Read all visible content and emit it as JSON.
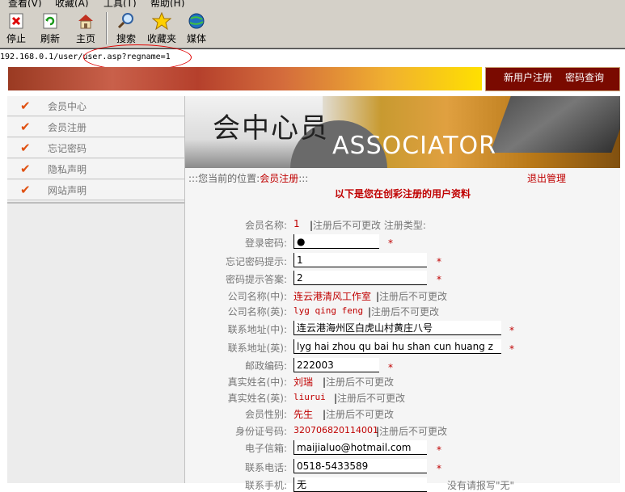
{
  "menubar": [
    "查看(V)",
    "收藏(A)",
    "工具(T)",
    "帮助(H)"
  ],
  "toolbar": [
    {
      "label": "停止",
      "icon": "stop-icon"
    },
    {
      "label": "刷新",
      "icon": "refresh-icon"
    },
    {
      "label": "主页",
      "icon": "home-icon"
    },
    {
      "label": "搜索",
      "icon": "search-icon"
    },
    {
      "label": "收藏夹",
      "icon": "star-icon"
    },
    {
      "label": "媒体",
      "icon": "media-icon"
    }
  ],
  "address": {
    "url": "192.168.0.1/user/user.asp?regname=1"
  },
  "banner": {
    "register_link": "新用户注册",
    "query_link": "密码查询"
  },
  "sidebar": {
    "items": [
      "会员中心",
      "会员注册",
      "忘记密码",
      "隐私声明",
      "网站声明"
    ]
  },
  "header": {
    "cn_text": "会中心员",
    "en_text": "ASSOCIATOR"
  },
  "breadcrumb": {
    "prefix": ":::您当前的位置:",
    "current": "会员注册",
    "suffix": ":::"
  },
  "logout": "退出管理",
  "heading": "以下是您在创彩注册的用户资料",
  "form": {
    "member_name": {
      "label": "会员名称:",
      "value": "1",
      "note": "注册后不可更改 注册类型:"
    },
    "password": {
      "label": "登录密码:",
      "value": "●",
      "star": "*"
    },
    "hint_q": {
      "label": "忘记密码提示:",
      "value": "1",
      "star": "*"
    },
    "hint_a": {
      "label": "密码提示答案:",
      "value": "2",
      "star": "*"
    },
    "company_cn": {
      "label": "公司名称(中):",
      "value": "连云港清风工作室",
      "note": "注册后不可更改"
    },
    "company_en": {
      "label": "公司名称(英):",
      "value": "lyg qing feng",
      "note": "注册后不可更改"
    },
    "addr_cn": {
      "label": "联系地址(中):",
      "value": "连云港海州区白虎山村黄庄八号",
      "star": "*"
    },
    "addr_en": {
      "label": "联系地址(英):",
      "value": "lyg hai zhou qu bai hu shan cun huang z",
      "star": "*"
    },
    "zip": {
      "label": "邮政编码:",
      "value": "222003",
      "star": "*"
    },
    "real_cn": {
      "label": "真实姓名(中):",
      "value": "刘瑞",
      "note": "注册后不可更改"
    },
    "real_en": {
      "label": "真实姓名(英):",
      "value": "liurui",
      "note": "注册后不可更改"
    },
    "gender": {
      "label": "会员性别:",
      "value": "先生",
      "note": "注册后不可更改"
    },
    "id_no": {
      "label": "身份证号码:",
      "value": "320706820114001",
      "note": "注册后不可更改"
    },
    "email": {
      "label": "电子信箱:",
      "value": "maijialuo@hotmail.com",
      "star": "*"
    },
    "phone": {
      "label": "联系电话:",
      "value": "0518-5433589",
      "star": "*"
    },
    "mobile": {
      "label": "联系手机:",
      "value": "无",
      "note": "没有请报写\"无\""
    }
  }
}
